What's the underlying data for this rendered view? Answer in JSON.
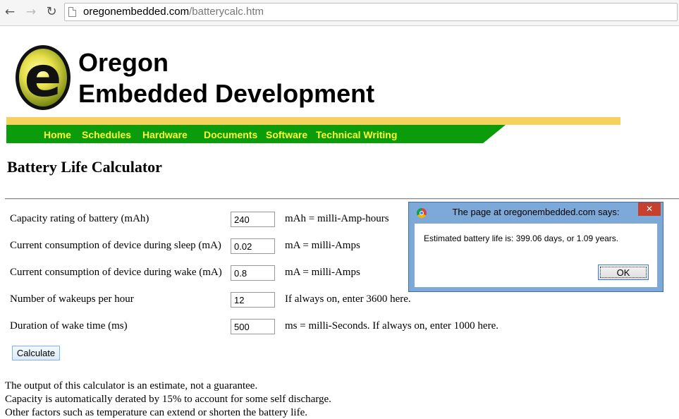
{
  "browser": {
    "url_domain": "oregonembedded.com",
    "url_path": "/batterycalc.htm",
    "back_icon": "back-arrow-icon",
    "forward_icon": "forward-arrow-icon",
    "reload_icon": "reload-icon"
  },
  "site": {
    "logo_letter": "e",
    "brand_line1": "Oregon",
    "brand_line2": "Embedded Development",
    "nav": [
      "Home",
      "Schedules",
      "Hardware",
      "Documents",
      "Software",
      "Technical Writing"
    ]
  },
  "page_title": "Battery Life Calculator",
  "form": {
    "rows": [
      {
        "label": "Capacity rating of battery (mAh)",
        "value": "240",
        "note": "mAh = milli-Amp-hours"
      },
      {
        "label": "Current consumption of device during sleep (mA)",
        "value": "0.02",
        "note": "mA = milli-Amps"
      },
      {
        "label": "Current consumption of device during wake (mA)",
        "value": "0.8",
        "note": "mA = milli-Amps"
      },
      {
        "label": "Number of wakeups per hour",
        "value": "12",
        "note": "If always on, enter 3600 here."
      },
      {
        "label": "Duration of wake time (ms)",
        "value": "500",
        "note": "ms = milli-Seconds. If always on, enter 1000 here."
      }
    ],
    "calculate_label": "Calculate"
  },
  "footer": [
    "The output of this calculator is an estimate, not a guarantee.",
    "Capacity is automatically derated by 15% to account for some self discharge.",
    "Other factors such as temperature can extend or shorten the battery life."
  ],
  "dialog": {
    "title": "The page at oregonembedded.com says:",
    "message": "Estimated battery life is: 399.06 days, or 1.09 years.",
    "ok_label": "OK",
    "close_label": "✕"
  },
  "colors": {
    "nav_green": "#0a9c0a",
    "nav_yellow": "#f5d25c",
    "nav_text": "#ffff33",
    "dialog_frame": "#7da9d9",
    "close_red": "#c7402f"
  }
}
